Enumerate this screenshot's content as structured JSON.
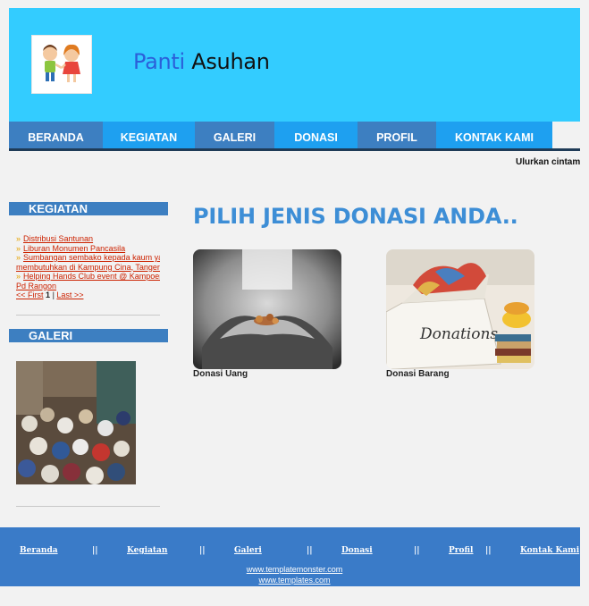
{
  "header": {
    "title_part1": "Panti",
    "title_part2": " Asuhan"
  },
  "nav": {
    "items": [
      {
        "label": "BERANDA"
      },
      {
        "label": "KEGIATAN"
      },
      {
        "label": "GALERI"
      },
      {
        "label": "DONASI"
      },
      {
        "label": "PROFIL"
      },
      {
        "label": "KONTAK KAMI"
      }
    ]
  },
  "marquee": {
    "text": "Ulurkan cintamu"
  },
  "sidebar": {
    "kegiatan_title": "KEGIATAN",
    "kegiatan_items": [
      "Distribusi Santunan",
      "Liburan Monumen Pancasila",
      "Sumbangan sembako kepada kaum yang",
      "membutuhkan di Kampung Cina, Tangerang",
      "Helping Hands Club event @ Kampoeng",
      "Pd Rangon"
    ],
    "pager": {
      "first": "<< First",
      "page": "1",
      "sep": "|",
      "last": "Last >>"
    },
    "galeri_title": "GALERI"
  },
  "main": {
    "heading": "PILIH JENIS DONASI ANDA..",
    "options": [
      {
        "label": "Donasi Uang"
      },
      {
        "label": "Donasi Barang"
      }
    ],
    "donations_box_text": "Donations"
  },
  "footer": {
    "links": [
      "Beranda",
      "Kegiatan",
      "Galeri",
      "Donasi",
      "Profil",
      "Kontak Kami"
    ],
    "separator": "||",
    "urls": [
      "www.templatemonster.com",
      "www.templates.com"
    ]
  }
}
